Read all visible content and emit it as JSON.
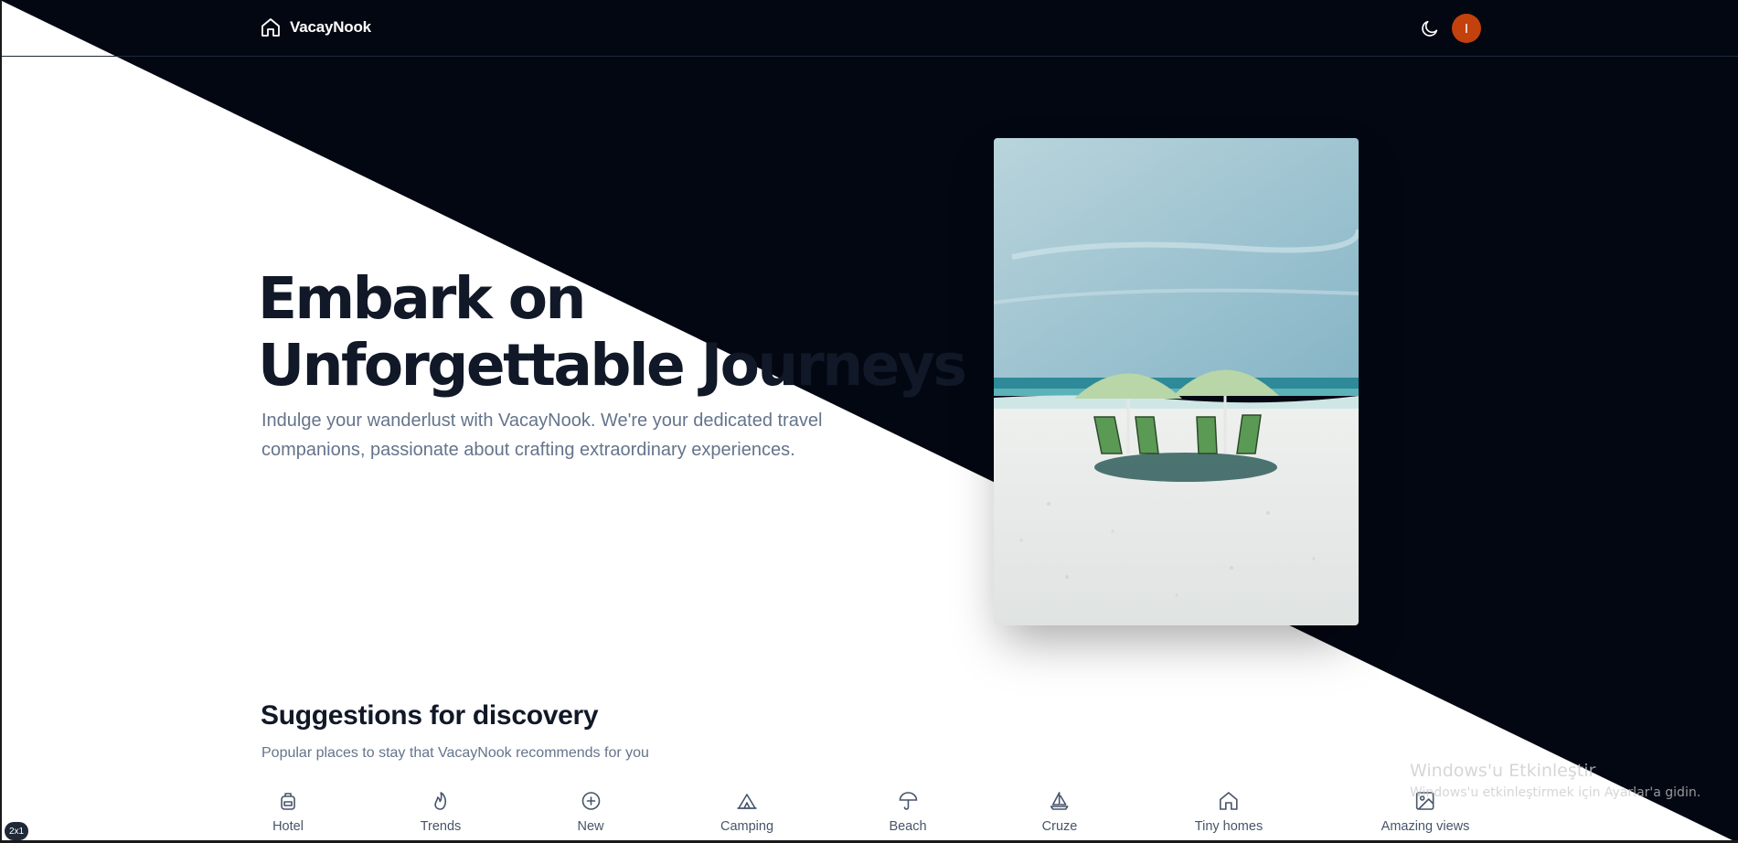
{
  "header": {
    "brand_name": "VacayNook",
    "avatar_initial": "I"
  },
  "hero": {
    "title_line1": "Embark on",
    "title_line2": "Unforgettable Journeys",
    "description": "Indulge your wanderlust with VacayNook. We're your dedicated travel companions, passionate about crafting extraordinary experiences.",
    "image_subject": "beach-umbrellas-and-chairs"
  },
  "suggestions": {
    "title": "Suggestions for discovery",
    "subtitle": "Popular places to stay that VacayNook recommends for you",
    "categories": [
      {
        "label": "Hotel",
        "icon": "backpack-icon"
      },
      {
        "label": "Trends",
        "icon": "flame-icon"
      },
      {
        "label": "New",
        "icon": "plus-circle-icon"
      },
      {
        "label": "Camping",
        "icon": "tent-icon"
      },
      {
        "label": "Beach",
        "icon": "umbrella-icon"
      },
      {
        "label": "Cruze",
        "icon": "sailboat-icon"
      },
      {
        "label": "Tiny homes",
        "icon": "home-icon"
      },
      {
        "label": "Amazing views",
        "icon": "image-icon"
      }
    ]
  },
  "watermark": {
    "line1": "Windows'u Etkinleştir",
    "line2": "Windows'u etkinleştirmek için Ayarlar'a gidin."
  },
  "corner_badge": "2x1",
  "colors": {
    "dark_bg": "#030712",
    "heading": "#111827",
    "muted_text": "#64748b",
    "avatar_bg": "#c2410c"
  }
}
